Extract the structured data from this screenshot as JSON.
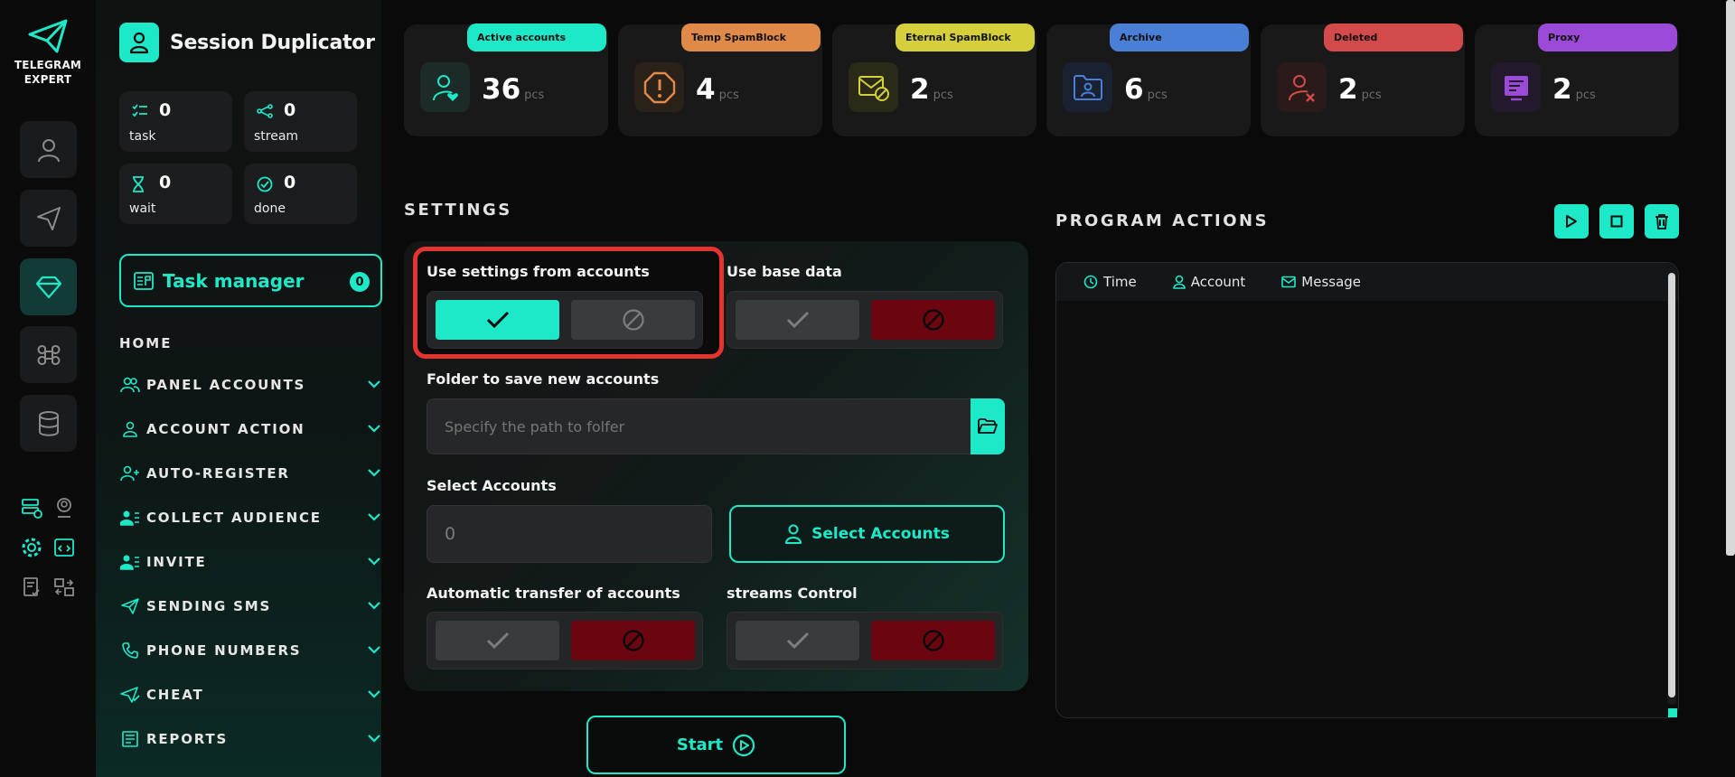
{
  "brand": {
    "line1": "TELEGRAM",
    "line2": "EXPERT"
  },
  "app": {
    "title": "Session Duplicator"
  },
  "stats": [
    {
      "value": "0",
      "label": "task",
      "icon": "list-icon"
    },
    {
      "value": "0",
      "label": "stream",
      "icon": "share-icon"
    },
    {
      "value": "0",
      "label": "wait",
      "icon": "hourglass-icon"
    },
    {
      "value": "0",
      "label": "done",
      "icon": "check-circle-icon"
    }
  ],
  "task_manager": {
    "label": "Task manager",
    "count": "0"
  },
  "nav": {
    "home": "HOME",
    "items": [
      {
        "label": "PANEL ACCOUNTS"
      },
      {
        "label": "ACCOUNT ACTION"
      },
      {
        "label": "AUTO-REGISTER"
      },
      {
        "label": "COLLECT AUDIENCE"
      },
      {
        "label": "INVITE"
      },
      {
        "label": "SENDING SMS"
      },
      {
        "label": "PHONE NUMBERS"
      },
      {
        "label": "CHEAT"
      },
      {
        "label": "REPORTS"
      }
    ]
  },
  "cards": [
    {
      "badge": "Active accounts",
      "value": "36",
      "unit": "pcs",
      "color": "#1de9c9"
    },
    {
      "badge": "Temp SpamBlock",
      "value": "4",
      "unit": "pcs",
      "color": "#e08a4a"
    },
    {
      "badge": "Eternal SpamBlock",
      "value": "2",
      "unit": "pcs",
      "color": "#d4cf3a"
    },
    {
      "badge": "Archive",
      "value": "6",
      "unit": "pcs",
      "color": "#4a7fd6"
    },
    {
      "badge": "Deleted",
      "value": "2",
      "unit": "pcs",
      "color": "#d24a4a"
    },
    {
      "badge": "Proxy",
      "value": "2",
      "unit": "pcs",
      "color": "#9a4ad6"
    }
  ],
  "settings": {
    "title": "SETTINGS",
    "use_settings_label": "Use settings from accounts",
    "use_base_label": "Use base data",
    "folder_label": "Folder to save new accounts",
    "folder_placeholder": "Specify the path to folfer",
    "select_label": "Select Accounts",
    "select_value": "0",
    "select_button": "Select Accounts",
    "auto_transfer_label": "Automatic transfer of accounts",
    "streams_label": "streams Control",
    "start": "Start"
  },
  "actions": {
    "title": "PROGRAM ACTIONS",
    "columns": [
      "Time",
      "Account",
      "Message"
    ]
  }
}
